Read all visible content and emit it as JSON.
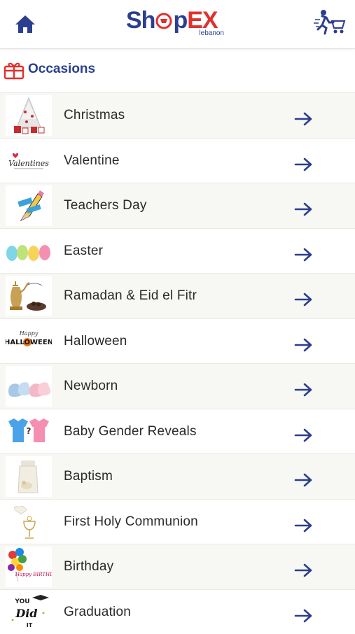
{
  "header": {
    "home_icon": "home-icon",
    "logo": {
      "text_a": "Sh",
      "text_b": "p",
      "text_c": "EX",
      "sub": "lebanon"
    },
    "cart_icon": "running-cart-icon"
  },
  "section": {
    "icon": "gift-icon",
    "title": "Occasions"
  },
  "occasions": [
    {
      "label": "Christmas",
      "thumb": "christmas-tree"
    },
    {
      "label": "Valentine",
      "thumb": "valentine-script"
    },
    {
      "label": "Teachers Day",
      "thumb": "pencil"
    },
    {
      "label": "Easter",
      "thumb": "eggs"
    },
    {
      "label": "Ramadan & Eid el Fitr",
      "thumb": "dallah"
    },
    {
      "label": "Halloween",
      "thumb": "halloween-text"
    },
    {
      "label": "Newborn",
      "thumb": "baby-shoes"
    },
    {
      "label": "Baby Gender Reveals",
      "thumb": "onesies"
    },
    {
      "label": "Baptism",
      "thumb": "baptism-bottle"
    },
    {
      "label": "First Holy Communion",
      "thumb": "chalice"
    },
    {
      "label": "Birthday",
      "thumb": "balloons"
    },
    {
      "label": "Graduation",
      "thumb": "you-did-it"
    }
  ],
  "thumb_text": {
    "valentine": "Valentines",
    "halloween": "HALLOWEEN",
    "halloween_top": "Happy",
    "birthday": "Happy BIRTHDAY",
    "grad_top": "YOU",
    "grad_mid": "Did",
    "grad_bot": "IT"
  },
  "colors": {
    "brand_blue": "#2c3e8f",
    "brand_red": "#e0312e",
    "row_alt": "#f7f7f3"
  }
}
